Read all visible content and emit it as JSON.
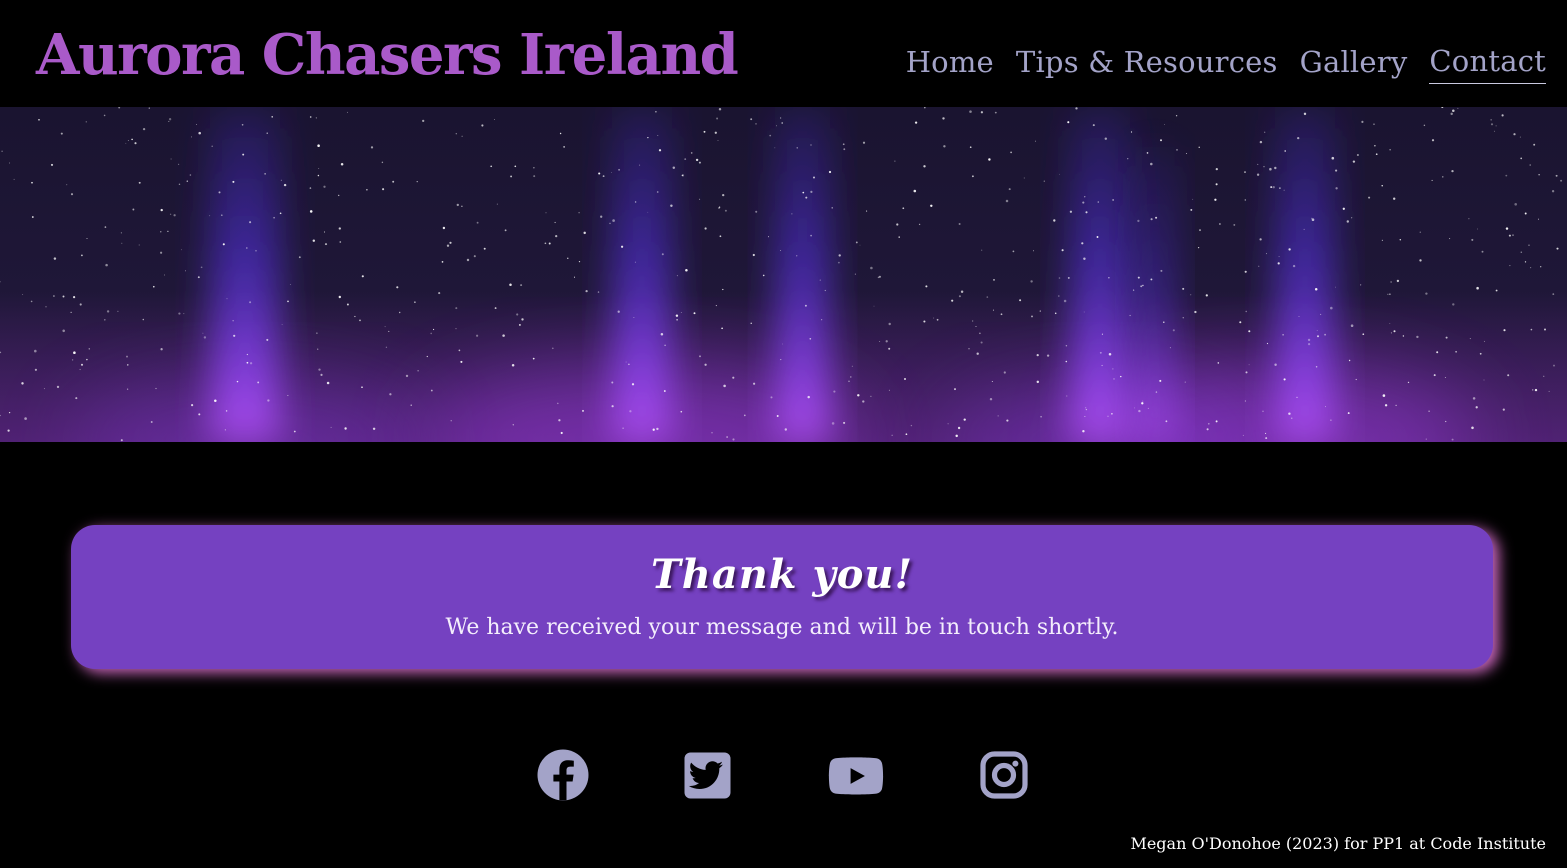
{
  "header": {
    "logo": "Aurora Chasers Ireland",
    "nav": [
      {
        "label": "Home",
        "active": false
      },
      {
        "label": "Tips & Resources",
        "active": false
      },
      {
        "label": "Gallery",
        "active": false
      },
      {
        "label": "Contact",
        "active": true
      }
    ]
  },
  "hero": {
    "image": "aurora-night-sky"
  },
  "confirmation": {
    "title": "Thank you!",
    "message": "We have received your message and will be in touch shortly."
  },
  "social": [
    {
      "icon": "facebook-icon"
    },
    {
      "icon": "twitter-icon"
    },
    {
      "icon": "youtube-icon"
    },
    {
      "icon": "instagram-icon"
    }
  ],
  "footer": {
    "credit": "Megan O'Donohoe (2023) for PP1 at Code Institute"
  },
  "colors": {
    "background": "#000000",
    "logo": "#a95ac9",
    "nav_text": "#a3a3c8",
    "card": "#7541c1",
    "card_glow": "#eb78dc",
    "icons": "#a3a3c8"
  }
}
